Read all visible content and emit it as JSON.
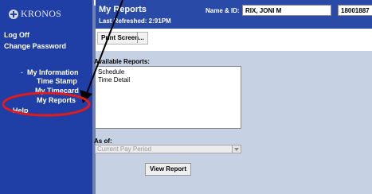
{
  "brand": {
    "logo_text": "KRONOS"
  },
  "header": {
    "title": "My Reports",
    "last_refreshed": "Last Refreshed: 2:91PM",
    "name_label": "Name & ID:",
    "name_value": "RIX, JONI M",
    "id_value": "18001887"
  },
  "sidebar": {
    "logoff": "Log Off",
    "change_password": "Change Password",
    "bullet": "-",
    "my_information": "My Information",
    "time_stamp": "Time Stamp",
    "my_timecard": "My Timecard",
    "my_reports": "My Reports",
    "help": "Help"
  },
  "toolbar": {
    "print_screen": "Print Screen..."
  },
  "reports": {
    "label": "Available Reports:",
    "items": [
      "Schedule",
      "Time Detail"
    ]
  },
  "as_of": {
    "label": "As of:",
    "selected": "Current Pay Period"
  },
  "actions": {
    "view_report": "View Report"
  },
  "colors": {
    "sidebar": "#1f3fa6",
    "header": "#2a4aa8",
    "panel": "#c6d1e4",
    "highlight_circle": "#e01b1b",
    "arrow": "#000000"
  }
}
